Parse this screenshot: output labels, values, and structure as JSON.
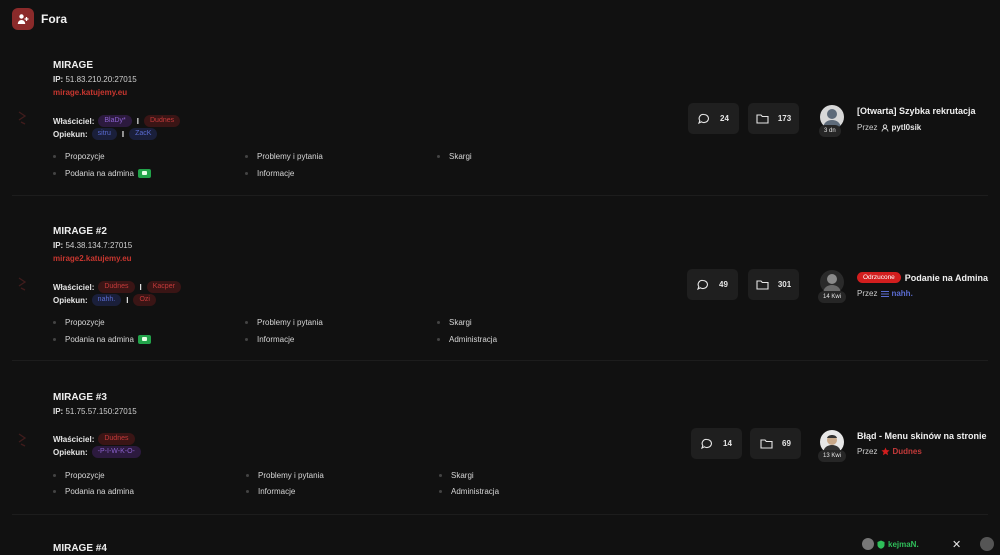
{
  "app": {
    "title": "Fora"
  },
  "servers": [
    {
      "name": "MIRAGE",
      "ip_label": "IP:",
      "ip": "51.83.210.20:27015",
      "url": "mirage.katujemy.eu",
      "owner_label": "Właściciel:",
      "owners": [
        "BlaDy*",
        "Dudnes"
      ],
      "keeper_label": "Opiekun:",
      "keepers": [
        "sitru",
        "ZacK"
      ],
      "subforums": [
        "Propozycje",
        "Problemy i pytania",
        "Skargi",
        "Podania na admina",
        "Informacje"
      ],
      "threads": "24",
      "posts": "173",
      "last_post": {
        "badge": "",
        "title": "[Otwarta] Szybka rekrutacja",
        "by_label": "Przez",
        "author": "pytl0sik",
        "age": "3 dn"
      }
    },
    {
      "name": "MIRAGE #2",
      "ip_label": "IP:",
      "ip": "54.38.134.7:27015",
      "url": "mirage2.katujemy.eu",
      "owner_label": "Właściciel:",
      "owners": [
        "Dudnes",
        "Kacper"
      ],
      "keeper_label": "Opiekun:",
      "keepers": [
        "nahh.",
        "Ozi"
      ],
      "subforums": [
        "Propozycje",
        "Problemy i pytania",
        "Skargi",
        "Podania na admina",
        "Informacje",
        "Administracja"
      ],
      "threads": "49",
      "posts": "301",
      "last_post": {
        "badge": "Odrzucone",
        "title": "Podanie na Admina",
        "by_label": "Przez",
        "author": "nahh.",
        "age": "14 Kwi"
      }
    },
    {
      "name": "MIRAGE #3",
      "ip_label": "IP:",
      "ip": "51.75.57.150:27015",
      "url": "",
      "owner_label": "Właściciel:",
      "owners": [
        "Dudnes"
      ],
      "keeper_label": "Opiekun:",
      "keepers": [
        "-P-I-W-K-O-"
      ],
      "subforums": [
        "Propozycje",
        "Problemy i pytania",
        "Skargi",
        "Podania na admina",
        "Informacje",
        "Administracja"
      ],
      "threads": "14",
      "posts": "69",
      "last_post": {
        "badge": "",
        "title": "Błąd - Menu skinów na stronie",
        "by_label": "Przez",
        "author": "Dudnes",
        "age": "13 Kwi"
      }
    },
    {
      "name": "MIRAGE #4"
    }
  ],
  "footer": {
    "online_user": "kejmaN.",
    "close": "✕"
  },
  "colors": {
    "accent": "#c7362f",
    "background": "#111111",
    "card": "#1f1f1f",
    "online": "#2fbf5a",
    "badge_rejected": "#d21e1e"
  }
}
